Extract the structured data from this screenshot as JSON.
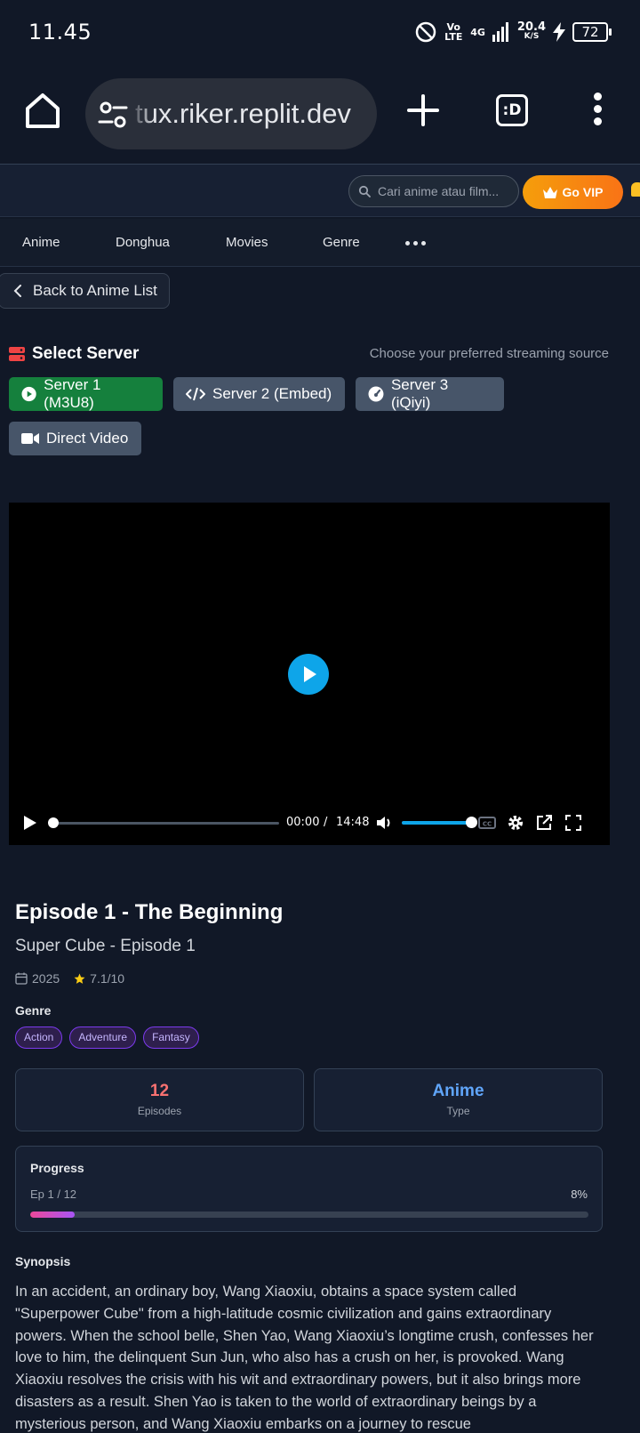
{
  "status_bar": {
    "time": "11.45",
    "network_volte": "Vo LTE",
    "network_4g": "4G",
    "speed_value": "20.4",
    "speed_unit": "K/S",
    "battery": "72"
  },
  "browser": {
    "url": "tux.riker.replit.dev",
    "tabs_label": ":D"
  },
  "header": {
    "search_placeholder": "Cari anime atau film...",
    "vip_label": "Go VIP",
    "accent_color": "#f59e0b"
  },
  "nav": {
    "items": [
      {
        "label": "Anime"
      },
      {
        "label": "Donghua"
      },
      {
        "label": "Movies"
      },
      {
        "label": "Genre"
      }
    ],
    "more_icon": "ellipsis-icon"
  },
  "back_button": {
    "label": "Back to Anime List"
  },
  "server": {
    "title": "Select Server",
    "subtitle": "Choose your preferred streaming source",
    "buttons": [
      {
        "label": "Server 1 (M3U8)",
        "icon": "play-circle-icon",
        "active": true
      },
      {
        "label": "Server 2 (Embed)",
        "icon": "code-icon",
        "active": false
      },
      {
        "label": "Server 3 (iQiyi)",
        "icon": "gauge-icon",
        "active": false
      },
      {
        "label": "Direct Video",
        "icon": "video-camera-icon",
        "active": false
      }
    ]
  },
  "player": {
    "current_time": "00:00",
    "separator": "/",
    "duration": "14:48",
    "seek_fraction": 0.0,
    "volume_fraction": 1.0,
    "accent_color": "#0ea5e9"
  },
  "episode": {
    "title": "Episode 1 - The Beginning",
    "subtitle": "Super Cube - Episode 1",
    "year": "2025",
    "rating": "7.1/10",
    "genre_label": "Genre",
    "genres": [
      "Action",
      "Adventure",
      "Fantasy"
    ]
  },
  "stats": {
    "episodes_value": "12",
    "episodes_label": "Episodes",
    "episodes_color": "#f87171",
    "type_value": "Anime",
    "type_label": "Type",
    "type_color": "#60a5fa"
  },
  "progress": {
    "title": "Progress",
    "episode_text": "Ep 1 / 12",
    "percent_text": "8%",
    "percent": 8
  },
  "synopsis": {
    "label": "Synopsis",
    "text": "In an accident, an ordinary boy, Wang Xiaoxiu, obtains a space system called \"Superpower Cube\" from a high-latitude cosmic civilization and gains extraordinary powers. When the school belle, Shen Yao, Wang Xiaoxiu’s longtime crush, confesses her love to him, the delinquent Sun Jun, who also has a crush on her, is provoked. Wang Xiaoxiu resolves the crisis with his wit and extraordinary powers, but it also brings more disasters as a result. Shen Yao is taken to the world of extraordinary beings by a mysterious person, and Wang Xiaoxiu embarks on a journey to rescue"
  }
}
